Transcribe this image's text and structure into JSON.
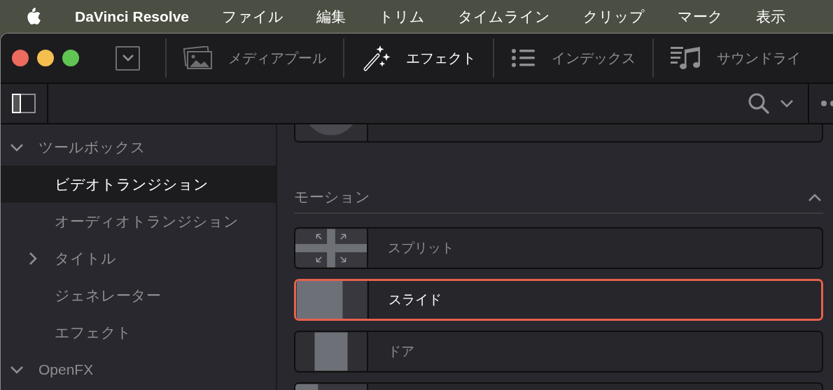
{
  "menu_bar": {
    "app_name": "DaVinci Resolve",
    "items": [
      "ファイル",
      "編集",
      "トリム",
      "タイムライン",
      "クリップ",
      "マーク",
      "表示"
    ]
  },
  "toolbar": [
    {
      "kind": "media",
      "label": "メディアプール",
      "selected": false
    },
    {
      "kind": "effects",
      "label": "エフェクト",
      "selected": true
    },
    {
      "kind": "index",
      "label": "インデックス",
      "selected": false
    },
    {
      "kind": "sound",
      "label": "サウンドライ",
      "selected": false
    }
  ],
  "sidebar": {
    "items": [
      {
        "label": "ツールボックス",
        "expanded": true,
        "selected": false,
        "children": [
          {
            "label": "ビデオトランジション",
            "selected": true
          },
          {
            "label": "オーディオトランジション",
            "selected": false
          },
          {
            "label": "タイトル",
            "expanded": false,
            "selected": false
          },
          {
            "label": "ジェネレーター",
            "selected": false
          },
          {
            "label": "エフェクト",
            "selected": false
          }
        ]
      },
      {
        "label": "OpenFX",
        "expanded": true,
        "selected": false
      }
    ]
  },
  "content": {
    "previous_items": [
      {
        "kind": "iris",
        "selected": false
      }
    ],
    "section": {
      "title": "モーション",
      "expanded": true,
      "items": [
        {
          "kind": "split",
          "label": "スプリット",
          "selected": false
        },
        {
          "kind": "slide",
          "label": "スライド",
          "selected": true
        },
        {
          "kind": "door",
          "label": "ドア",
          "selected": false
        },
        {
          "kind": "edge",
          "selected": false
        }
      ]
    }
  }
}
